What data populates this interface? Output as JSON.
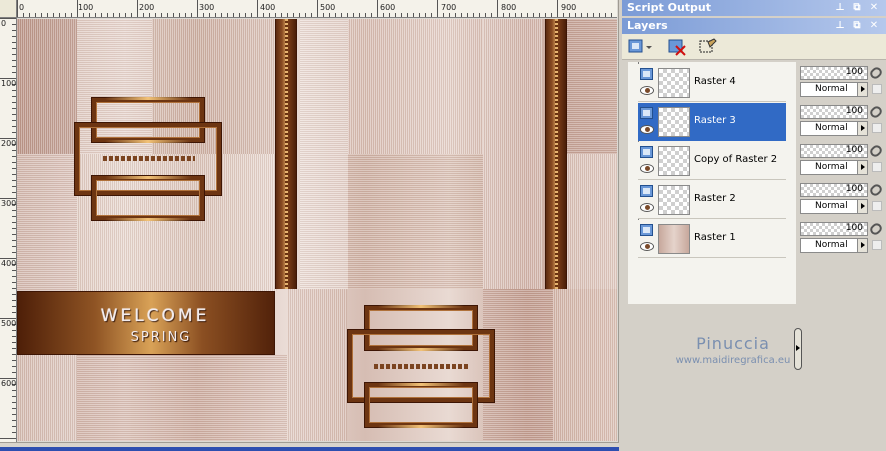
{
  "rulers": {
    "horizontal": [
      "0",
      "100",
      "200",
      "300",
      "400",
      "500",
      "600",
      "700",
      "800",
      "900"
    ],
    "vertical": [
      "0",
      "100",
      "200",
      "300",
      "400",
      "500",
      "600"
    ]
  },
  "canvas": {
    "banner_title": "WELCOME",
    "banner_subtitle": "SPRING"
  },
  "panels": {
    "script_output": {
      "title": "Script Output"
    },
    "layers": {
      "title": "Layers",
      "items": [
        {
          "name": "Raster 4",
          "opacity": "100",
          "blend": "Normal",
          "active": false
        },
        {
          "name": "Raster 3",
          "opacity": "100",
          "blend": "Normal",
          "active": true
        },
        {
          "name": "Copy of Raster 2",
          "opacity": "100",
          "blend": "Normal",
          "active": false
        },
        {
          "name": "Raster 2",
          "opacity": "100",
          "blend": "Normal",
          "active": false
        },
        {
          "name": "Raster 1",
          "opacity": "100",
          "blend": "Normal",
          "active": false
        }
      ]
    }
  },
  "watermark": {
    "name": "Pinuccia",
    "url": "www.maidiregrafica.eu"
  },
  "colors": {
    "title_bar": "#7b9bd6",
    "selection": "#316ac5",
    "accent_brown": "#6d3512",
    "gold": "#f2c277"
  },
  "icons": [
    "new-layer-icon",
    "delete-layer-icon",
    "edit-selection-icon",
    "layer-type-icon",
    "eye-icon",
    "link-icon",
    "pin-icon",
    "restore-icon",
    "close-icon"
  ]
}
